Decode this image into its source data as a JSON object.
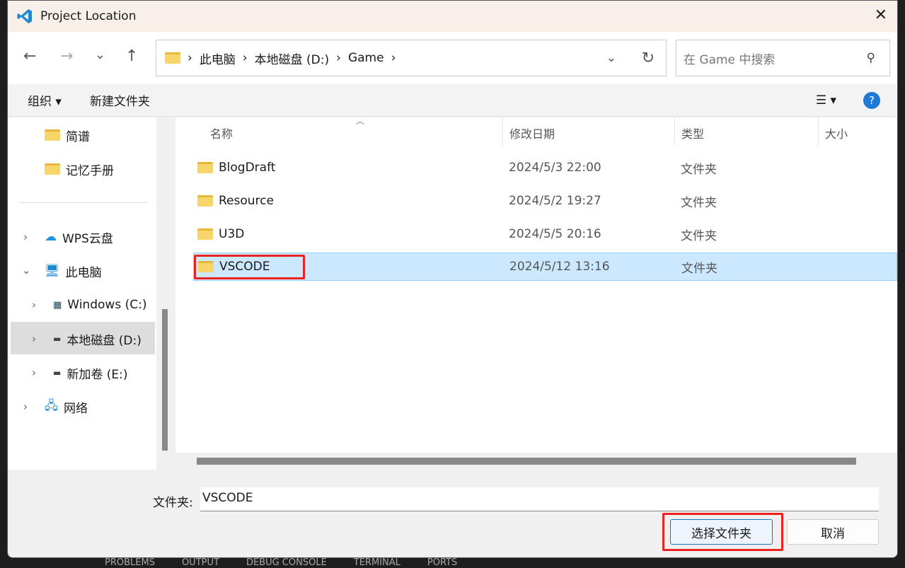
{
  "window": {
    "title": "Project Location",
    "close": "✕"
  },
  "nav": {
    "back": "←",
    "forward": "→",
    "recent": "⌄",
    "up": "↑",
    "breadcrumb": [
      "此电脑",
      "本地磁盘 (D:)",
      "Game"
    ],
    "refresh": "↻",
    "search_placeholder": "在 Game 中搜索"
  },
  "toolbar": {
    "organize": "组织 ▾",
    "new_folder": "新建文件夹",
    "view": "☰ ▾",
    "help": "?"
  },
  "sidebar": {
    "items": [
      {
        "label": "简谱"
      },
      {
        "label": "记忆手册"
      },
      {
        "label": "WPS云盘"
      },
      {
        "label": "此电脑"
      },
      {
        "label": "Windows (C:)"
      },
      {
        "label": "本地磁盘 (D:)",
        "selected": true
      },
      {
        "label": "新加卷 (E:)"
      },
      {
        "label": "网络"
      }
    ]
  },
  "columns": [
    "名称",
    "修改日期",
    "类型",
    "大小"
  ],
  "files": [
    {
      "name": "BlogDraft",
      "date": "2024/5/3 22:00",
      "type": "文件夹"
    },
    {
      "name": "Resource",
      "date": "2024/5/2 19:27",
      "type": "文件夹"
    },
    {
      "name": "U3D",
      "date": "2024/5/5 20:16",
      "type": "文件夹"
    },
    {
      "name": "VSCODE",
      "date": "2024/5/12 13:16",
      "type": "文件夹",
      "selected": true
    }
  ],
  "footer": {
    "folder_label": "文件夹:",
    "folder_value": "VSCODE",
    "select": "选择文件夹",
    "cancel": "取消"
  },
  "background_tabs": [
    "PROBLEMS",
    "OUTPUT",
    "DEBUG CONSOLE",
    "TERMINAL",
    "PORTS"
  ]
}
